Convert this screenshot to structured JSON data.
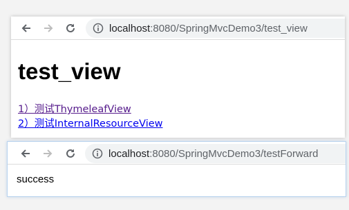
{
  "browser_top": {
    "url_host": "localhost",
    "url_rest": ":8080/SpringMvcDemo3/test_view"
  },
  "page_top": {
    "title": "test_view",
    "links": [
      "1）测试ThymeleafView",
      "2）测试InternalResourceView"
    ]
  },
  "browser_bottom": {
    "url_host": "localhost",
    "url_rest": ":8080/SpringMvcDemo3/testForward"
  },
  "page_bottom": {
    "text": "success"
  },
  "colors": {
    "visited_link": "#551a8b",
    "unvisited_link": "#0000ee",
    "omnibox_bg": "#f1f3f4"
  },
  "icons": [
    "back-arrow-icon",
    "forward-arrow-icon",
    "reload-icon",
    "info-icon"
  ]
}
